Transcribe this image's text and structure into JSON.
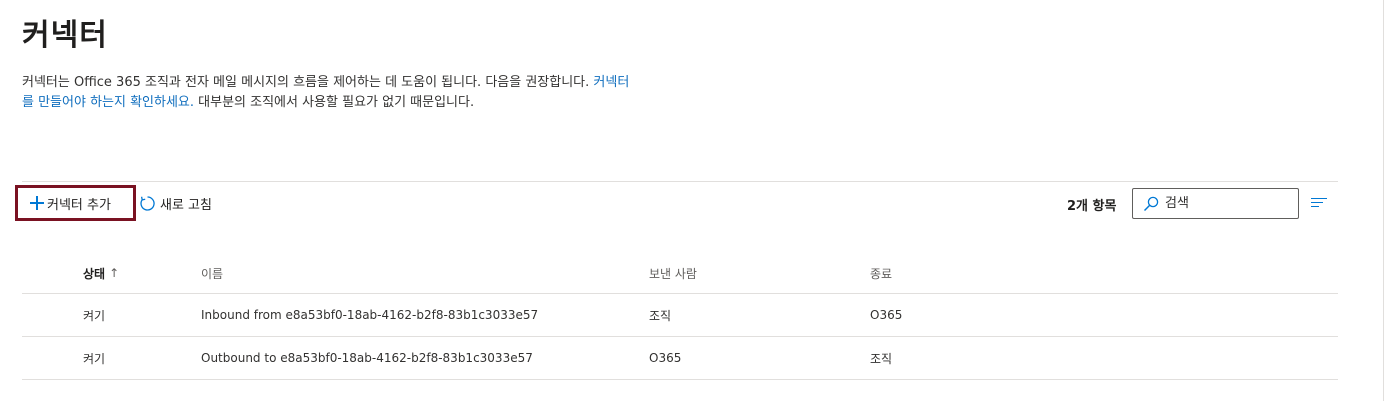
{
  "header": {
    "title": "커넥터"
  },
  "description": {
    "text_before": "커넥터는 Office 365 조직과 전자 메일 메시지의 흐름을 제어하는 데 도움이 됩니다. 다음을 권장합니다. ",
    "link_text": "커넥터를 만들어야 하는지 확인하세요.",
    "text_after": " 대부분의 조직에서 사용할 필요가 없기 때문입니다."
  },
  "toolbar": {
    "add_label": "커넥터 추가",
    "refresh_label": "새로 고침",
    "item_count": "2개 항목",
    "search_placeholder": "검색",
    "search_value": ""
  },
  "table": {
    "columns": {
      "status": "상태",
      "sort_indicator": "↑",
      "name": "이름",
      "from": "보낸 사람",
      "to": "종료"
    },
    "rows": [
      {
        "status": "켜기",
        "name": "Inbound from e8a53bf0-18ab-4162-b2f8-83b1c3033e57",
        "from": "조직",
        "to": "O365"
      },
      {
        "status": "켜기",
        "name": "Outbound to e8a53bf0-18ab-4162-b2f8-83b1c3033e57",
        "from": "O365",
        "to": "조직"
      }
    ]
  },
  "colors": {
    "accent": "#0078d4",
    "link": "#106ebe",
    "focus_highlight": "#7a1222",
    "divider": "#e1dfdd"
  }
}
